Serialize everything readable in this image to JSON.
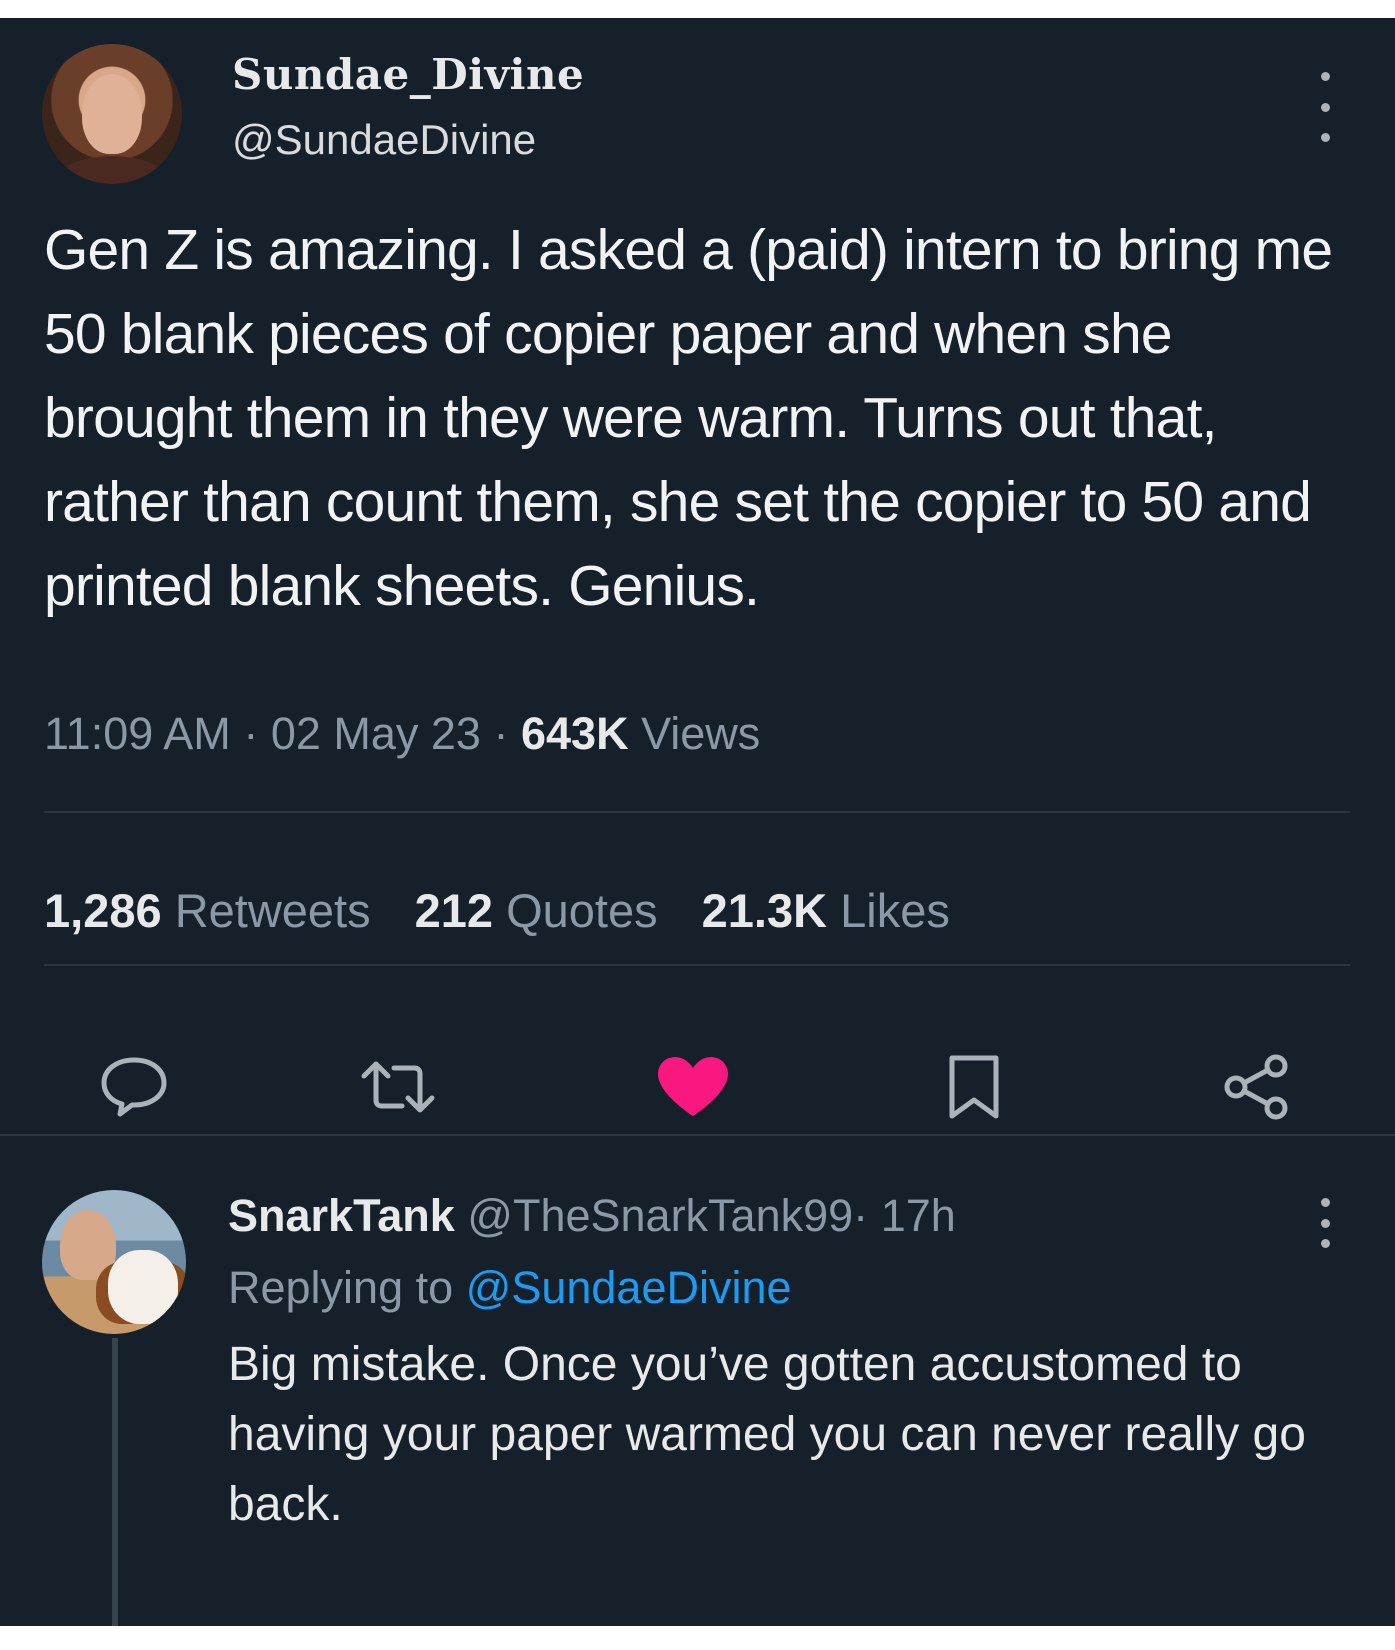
{
  "tweet": {
    "author_name": "Sundae_Divine",
    "author_handle": "@SundaeDivine",
    "text": "Gen Z is amazing. I asked a (paid) intern to bring me 50 blank pieces of copier paper and when she brought them in they were warm. Turns out that, rather than count them, she set the copier to 50 and printed blank sheets. Genius.",
    "time": "11:09 AM",
    "date": "02 May 23",
    "views_count": "643K",
    "views_label": "Views",
    "separator": "·"
  },
  "stats": {
    "retweets_count": "1,286",
    "retweets_label": "Retweets",
    "quotes_count": "212",
    "quotes_label": "Quotes",
    "likes_count": "21.3K",
    "likes_label": "Likes"
  },
  "actions": [
    {
      "name": "reply",
      "icon": "reply-icon"
    },
    {
      "name": "retweet",
      "icon": "retweet-icon"
    },
    {
      "name": "like",
      "icon": "heart-icon",
      "active": true,
      "color": "#f91880"
    },
    {
      "name": "bookmark",
      "icon": "bookmark-icon"
    },
    {
      "name": "share",
      "icon": "share-icon"
    }
  ],
  "reply": {
    "author_name": "SnarkTank",
    "author_handle": "@TheSnarkTank99",
    "separator": "·",
    "time_ago": "17h",
    "replying_prefix": "Replying to",
    "replying_to": "@SundaeDivine",
    "text": "Big mistake. Once you’ve gotten accustomed to having your paper warmed you can never really go back."
  },
  "colors": {
    "background": "#16202b",
    "link": "#1d9bf0",
    "like": "#f91880",
    "muted": "#8b98a5"
  }
}
